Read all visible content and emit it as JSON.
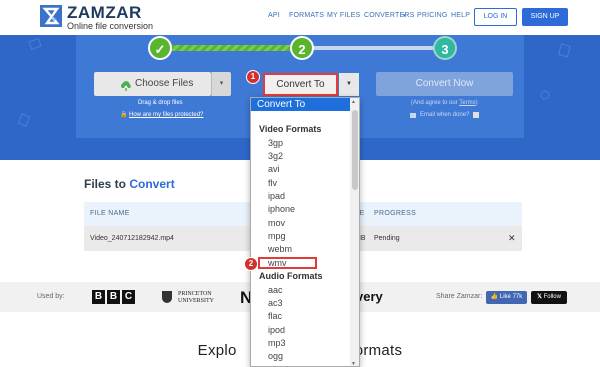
{
  "header": {
    "brand": "ZAMZAR",
    "tagline": "Online file conversion",
    "nav": [
      "API",
      "FORMATS",
      "MY FILES",
      "CONVERTERS",
      "PRICING",
      "HELP"
    ],
    "login": "LOG IN",
    "signup": "SIGN UP"
  },
  "steps": {
    "step1": "✓",
    "step2": "2",
    "step3": "3"
  },
  "hero": {
    "choose_files": "Choose Files",
    "drag_drop": "Drag & drop files",
    "protected_link": "How are my files protected?",
    "convert_to": "Convert To",
    "convert_now": "Convert Now",
    "agree_text": "(And agree to our",
    "terms": "Terms",
    "agree_close": ")",
    "email_done": "Email when done?",
    "badge1": "1",
    "badge2": "2"
  },
  "dropdown": {
    "selected": "Convert To",
    "video_group": "Video Formats",
    "video_items": [
      "3gp",
      "3g2",
      "avi",
      "flv",
      "ipad",
      "iphone",
      "mov",
      "mpg",
      "webm",
      "wmv"
    ],
    "audio_group": "Audio Formats",
    "audio_items": [
      "aac",
      "ac3",
      "flac",
      "ipod",
      "mp3",
      "ogg"
    ]
  },
  "files": {
    "title_prefix": "Files to",
    "title_accent": "Convert",
    "col_name": "FILE NAME",
    "col_size": "ZE",
    "col_progress": "PROGRESS",
    "row": {
      "name": "Video_240712182942.mp4",
      "size": "MB",
      "progress": "Pending",
      "remove": "✕"
    }
  },
  "usedby": {
    "label": "Used by:",
    "bbc": [
      "B",
      "B",
      "C"
    ],
    "princeton1": "PRINCETON",
    "princeton2": "UNIVERSITY",
    "logo_n": "N",
    "logo_very": "very",
    "share": "Share Zamzar:",
    "fb": "Like 77k",
    "x": "Follow"
  },
  "explore": {
    "left": "Explo",
    "right": "ormats"
  },
  "colors": {
    "brand_blue": "#2e6ad8",
    "hero_bg": "#2f67c9",
    "highlight_red": "#e53a3a",
    "step_green": "#5ab52e",
    "step_teal": "#30b8a0"
  }
}
